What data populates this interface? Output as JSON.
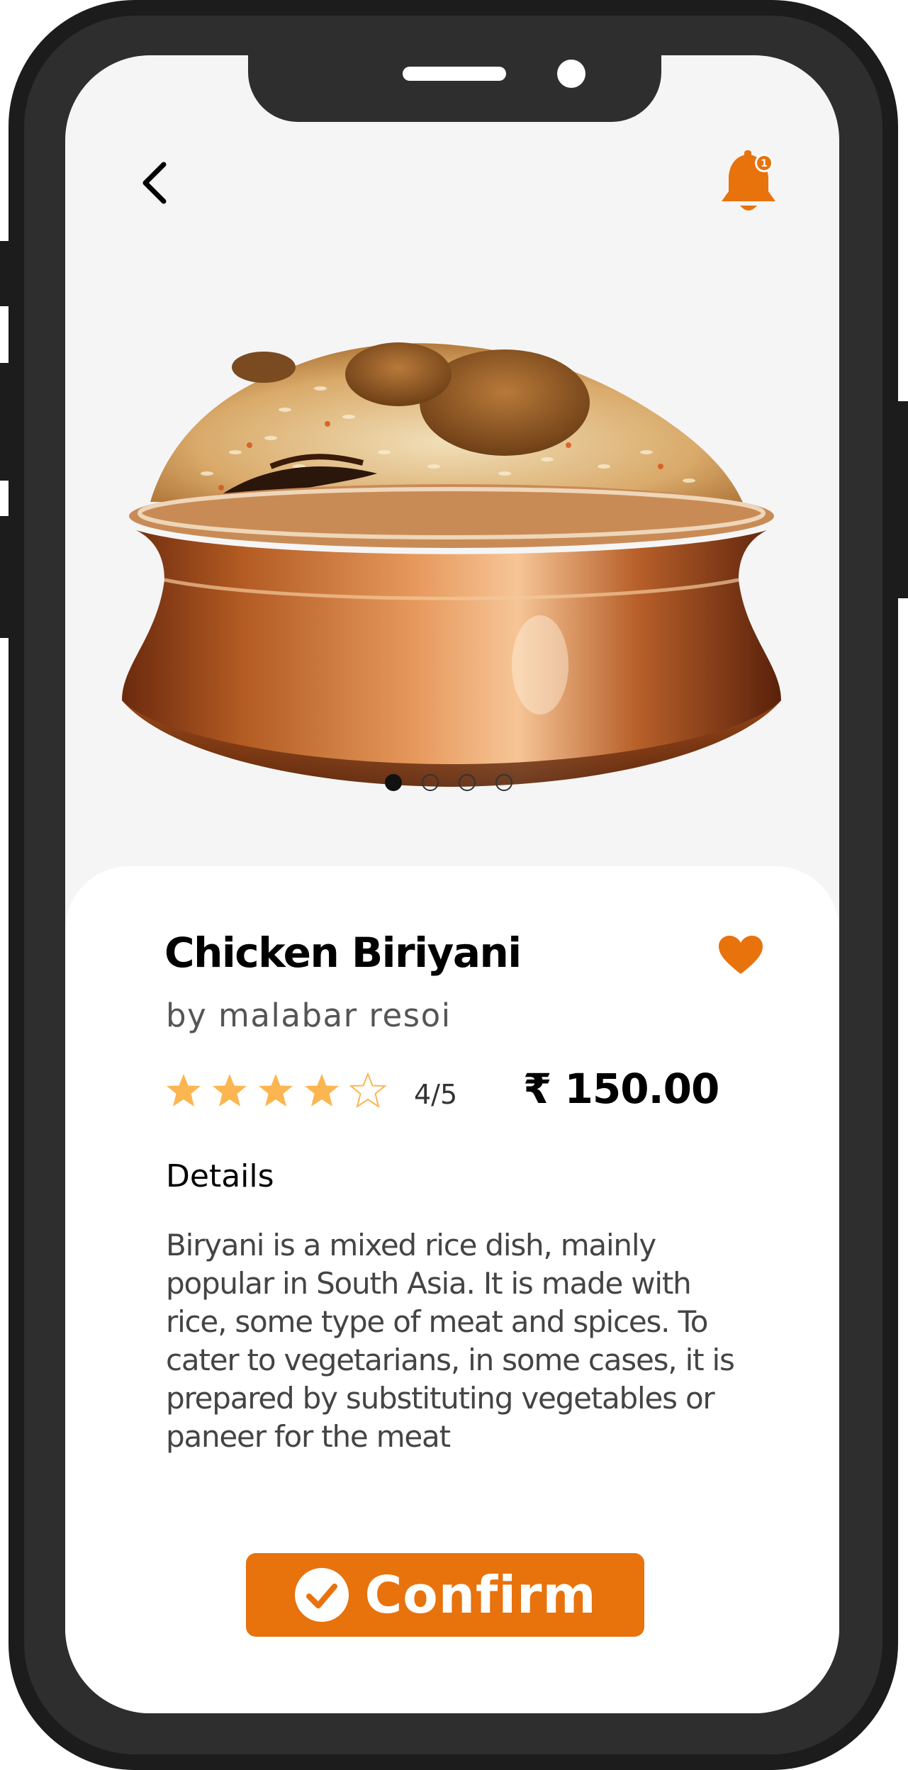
{
  "colors": {
    "accent": "#e8720c",
    "star": "#fbb651",
    "screen_bg": "#f5f5f5",
    "card_bg": "#ffffff",
    "phone_frame": "#2e2e2e"
  },
  "header": {
    "back_icon": "chevron-left-icon",
    "notification_icon": "bell-icon",
    "notification_count": "1"
  },
  "carousel": {
    "image_alt": "chicken-biriyani-copper-bowl",
    "slide_count": 4,
    "active_index": 0
  },
  "product": {
    "name": "Chicken Biriyani",
    "vendor": "by malabar resoi",
    "favorite_icon": "heart-icon",
    "rating": 4,
    "rating_max": 5,
    "rating_text": "4/5",
    "price": "₹ 150.00",
    "details_heading": "Details",
    "description": "Biryani is a mixed rice dish, mainly popular in South Asia. It is made with rice, some type of meat and spices. To cater to vegetarians, in some cases, it is prepared by substituting vegetables or paneer for the meat"
  },
  "actions": {
    "confirm_label": "Confirm",
    "confirm_icon": "check-circle-icon"
  }
}
